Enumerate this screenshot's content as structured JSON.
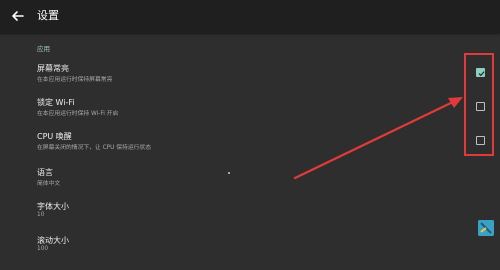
{
  "appbar": {
    "title": "设置",
    "back_icon": "arrow-back-icon"
  },
  "section": {
    "title": "应用"
  },
  "settings": [
    {
      "title": "屏幕常亮",
      "subtitle": "在本应用运行时保持屏幕常亮",
      "checked": true
    },
    {
      "title": "锁定 Wi-Fi",
      "subtitle": "在本应用运行时保持 Wi-Fi 开启",
      "checked": false
    },
    {
      "title": "CPU 唤醒",
      "subtitle": "在屏幕关闭的情况下，让 CPU 保持运行状态",
      "checked": false
    },
    {
      "title": "语言",
      "subtitle": "简体中文"
    },
    {
      "title": "字体大小",
      "subtitle": "10"
    },
    {
      "title": "滚动大小",
      "subtitle": "100"
    }
  ],
  "colors": {
    "highlight": "#e23a3a",
    "accent": "#8ecfc3",
    "background": "#2e2e2e",
    "appbar": "#1f1f1f"
  }
}
